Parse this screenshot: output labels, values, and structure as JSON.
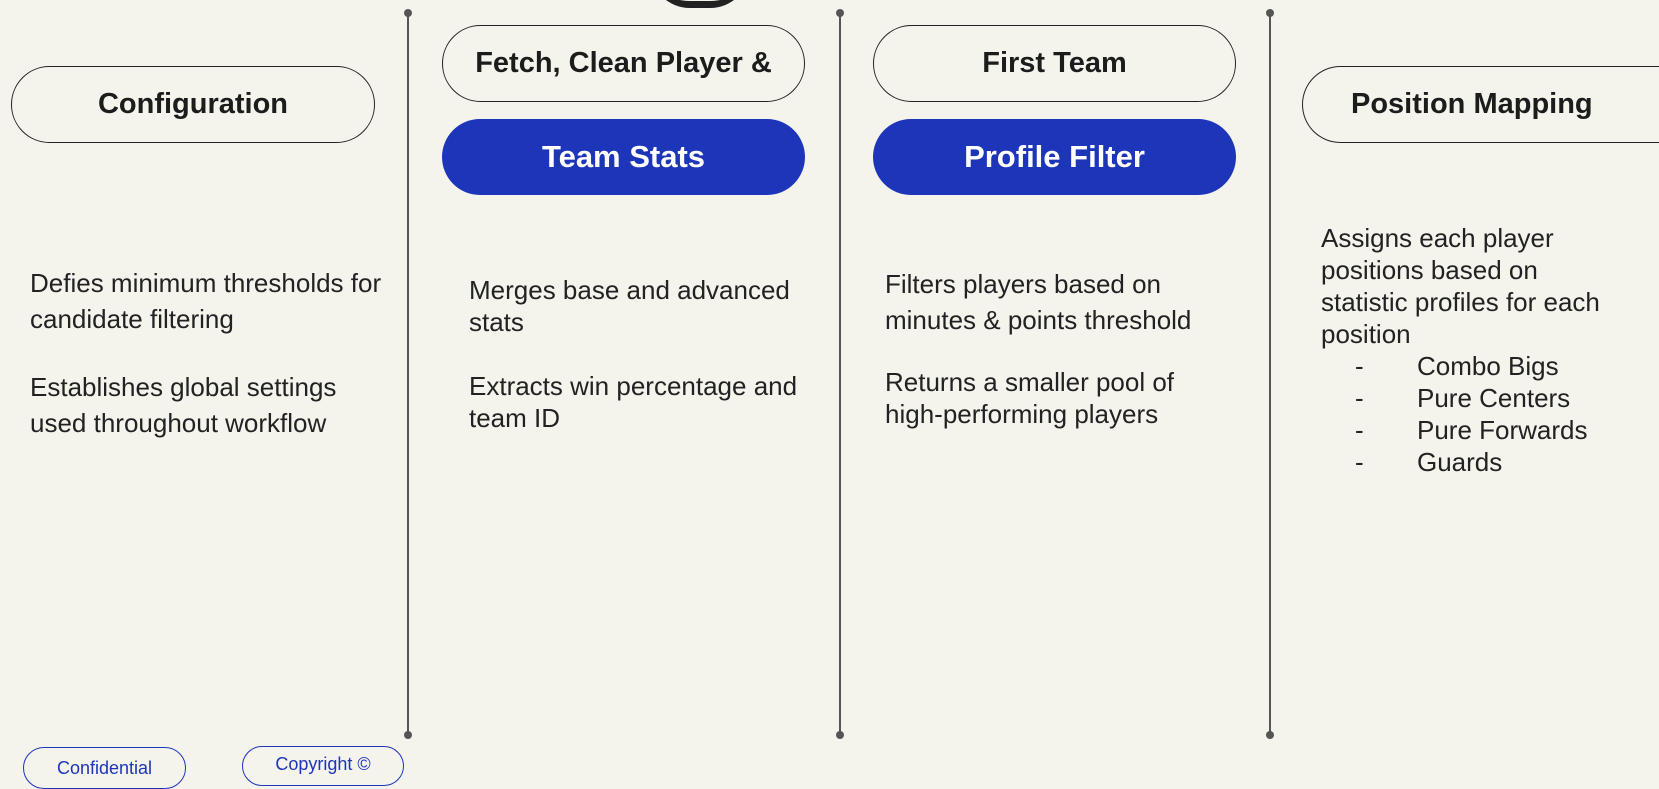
{
  "columns": [
    {
      "title_line1": "Configuration",
      "title_line2": "",
      "paragraphs": [
        "Defies minimum thresholds for candidate filtering",
        "Establishes global settings used throughout workflow"
      ]
    },
    {
      "title_line1": "Fetch, Clean Player &",
      "title_line2": "Team Stats",
      "paragraphs": [
        "Merges base and advanced stats",
        "Extracts win percentage and team ID"
      ]
    },
    {
      "title_line1": "First Team",
      "title_line2": "Profile Filter",
      "paragraphs": [
        "Filters players based on minutes & points threshold",
        "Returns a smaller pool of high-performing players"
      ]
    },
    {
      "title_line1": "Position Mapping",
      "title_line2": "",
      "intro": "Assigns each player positions based on statistic profiles for each position",
      "bullet_marker": "-",
      "bullets": [
        "Combo Bigs",
        "Pure Centers",
        "Pure Forwards",
        "Guards"
      ]
    }
  ],
  "footer": {
    "confidential": "Confidential",
    "copyright": "Copyright ©"
  },
  "colors": {
    "background": "#f4f3ec",
    "accent": "#1d35b9",
    "text": "#1c1c1c",
    "divider": "#555555"
  }
}
